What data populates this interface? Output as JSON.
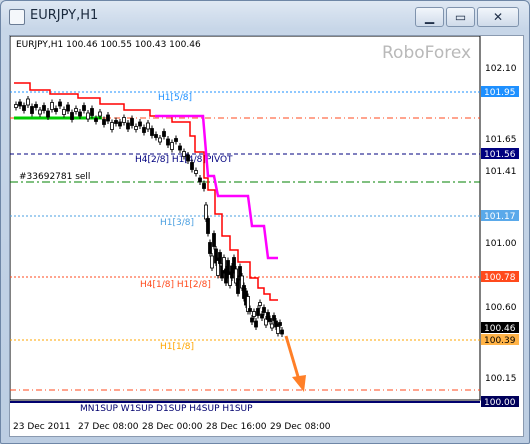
{
  "window": {
    "title": "EURJPY,H1",
    "minimize_glyph": "▁",
    "maximize_glyph": "▭",
    "close_glyph": "✕"
  },
  "chart": {
    "header": "EURJPY,H1  100.46 100.55 100.43 100.46",
    "watermark": "RoboForex",
    "order_label": "#33692781 sell",
    "bottom_label": "MN1SUP W1SUP D1SUP H4SUP H1SUP",
    "x_ticks": [
      "23 Dec 2011",
      "27 Dec 08:00",
      "28 Dec 00:00",
      "28 Dec 16:00",
      "29 Dec 08:00"
    ],
    "y_ticks": [
      "102.10",
      "101.65",
      "101.41",
      "101.00",
      "100.60",
      "100.15"
    ],
    "price_boxes": [
      {
        "text": "101.95",
        "bg": "#1e90ff",
        "fg": "#ffffff"
      },
      {
        "text": "101.56",
        "bg": "#00007f",
        "fg": "#ffffff"
      },
      {
        "text": "101.17",
        "bg": "#5aa9ea",
        "fg": "#ffffff"
      },
      {
        "text": "100.78",
        "bg": "#ff4a1c",
        "fg": "#ffffff"
      },
      {
        "text": "100.46",
        "bg": "#000000",
        "fg": "#ffffff"
      },
      {
        "text": "100.39",
        "bg": "#ffb347",
        "fg": "#000000"
      },
      {
        "text": "100.00",
        "bg": "#00005a",
        "fg": "#ffffff"
      }
    ],
    "levels": [
      {
        "label": "H1[5/8]",
        "color": "#1e90ff"
      },
      {
        "label": "H4[2/8] H1[4/8]PIVOT",
        "color": "#00007f"
      },
      {
        "label": "H1[3/8]",
        "color": "#4a9fe0"
      },
      {
        "label": "H4[1/8] H1[2/8]",
        "color": "#ff4a1c"
      },
      {
        "label": "H1[1/8]",
        "color": "#ffa500"
      }
    ],
    "colors": {
      "candles": "#000000",
      "red_line": "#ff0000",
      "magenta_line": "#ff00ff",
      "green_line": "#00cc00",
      "arrow": "#ff7f27",
      "order_line": "#008000",
      "support_line": "#00006e"
    }
  }
}
